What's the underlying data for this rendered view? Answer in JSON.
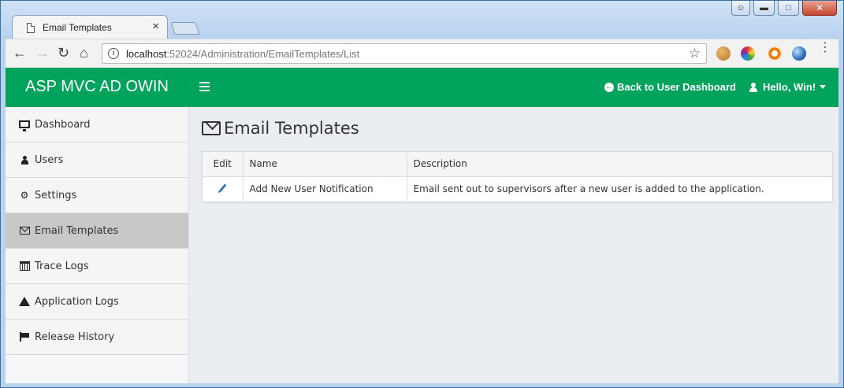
{
  "browser": {
    "tab_title": "Email Templates",
    "tab_close": "×",
    "url_host": "localhost",
    "url_rest": ":52024/Administration/EmailTemplates/List"
  },
  "navbar": {
    "brand": "ASP MVC AD OWIN",
    "back_link": "Back to User Dashboard",
    "user_greeting": "Hello, Win!"
  },
  "sidebar": {
    "items": [
      {
        "label": "Dashboard",
        "icon": "monitor-icon"
      },
      {
        "label": "Users",
        "icon": "user-icon"
      },
      {
        "label": "Settings",
        "icon": "gear-icon"
      },
      {
        "label": "Email Templates",
        "icon": "envelope-icon",
        "active": true
      },
      {
        "label": "Trace Logs",
        "icon": "calendar-icon"
      },
      {
        "label": "Application Logs",
        "icon": "warning-icon"
      },
      {
        "label": "Release History",
        "icon": "flag-icon"
      }
    ]
  },
  "main": {
    "title": "Email Templates",
    "table": {
      "headers": [
        "Edit",
        "Name",
        "Description"
      ],
      "rows": [
        {
          "name": "Add New User Notification",
          "description": "Email sent out to supervisors after a new user is added to the application."
        }
      ]
    }
  },
  "colors": {
    "navbar": "#00a35c",
    "active_sidebar": "#c8c8c8",
    "content_bg": "#eaeef3",
    "edit_icon": "#337ab7"
  }
}
